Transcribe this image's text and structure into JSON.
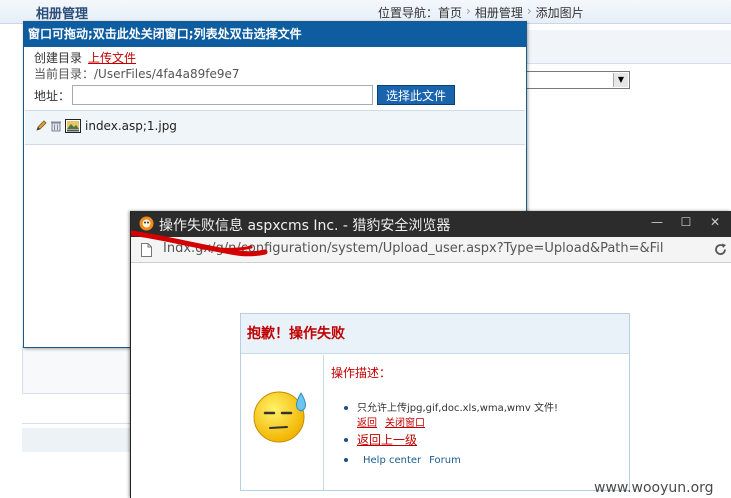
{
  "background": {
    "title": "相册管理",
    "breadcrumb": [
      "位置导航：首页",
      "相册管理",
      "添加图片"
    ],
    "breadcrumb_sep": "›"
  },
  "dialog": {
    "title": "窗口可拖动;双击此处关闭窗口;列表处双击选择文件",
    "create_dir": "创建目录",
    "upload_file": "上传文件",
    "current_dir": "当前目录：/UserFiles/4fa4a89fe9e7",
    "addr_label": "地址：",
    "addr_value": "",
    "select_button": "选择此文件",
    "file": {
      "name": "index.asp;1.jpg",
      "icon": "image-file-icon"
    }
  },
  "popup": {
    "window_title": "操作失败信息 aspxcms Inc. - 猎豹安全浏览器",
    "url": "Indx.gx/g/n/configuration/system/Upload_user.aspx?Type=Upload&Path=&Fil",
    "window_controls": [
      "—",
      "☐",
      "✕"
    ],
    "error": {
      "heading": "抱歉！操作失败",
      "desc_label": "操作描述：",
      "message": "只允许上传jpg,gif,doc.xls,wma,wmv 文件!",
      "links": [
        "返回",
        "关闭窗口"
      ],
      "back_up": "返回上一级",
      "help_links": [
        "Help center",
        "Forum"
      ]
    }
  },
  "watermark": "www.wooyun.org",
  "colors": {
    "dialog_title_bg": "#0e5da1",
    "popup_titlebar_bg": "#2c2c2c",
    "error_red": "#c00000",
    "redaction_red": "#d40000"
  }
}
